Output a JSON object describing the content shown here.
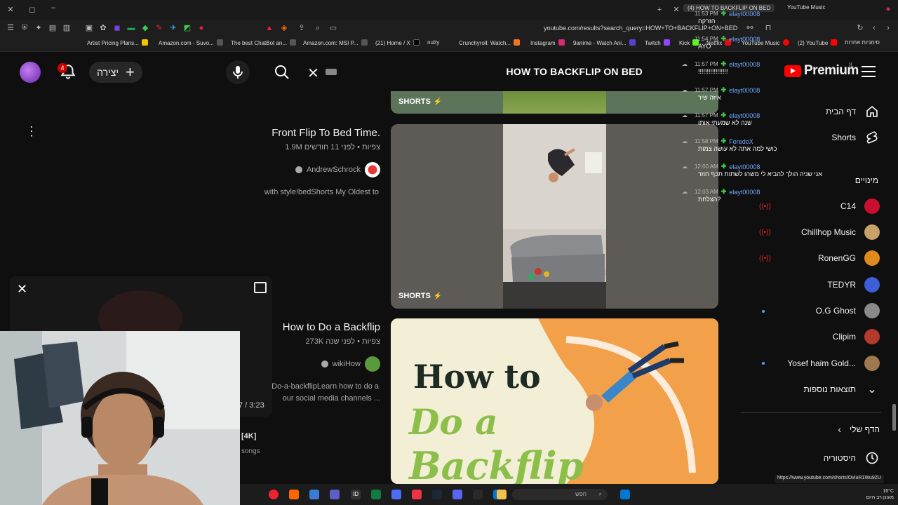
{
  "browser": {
    "tabs": [
      {
        "label": "(4) HOW TO BACKFLIP ON BED",
        "active": true
      },
      {
        "label": "YouTube Music",
        "active": false
      }
    ],
    "url": "youtube.com/results?search_query=HOW+TO+BACKFLIP+ON+BED",
    "bookmarks": [
      "Artist Pricing Plans...",
      "Amazon.com - Suvo...",
      "The best ChatBot an...",
      "Amazon.com: MSI P...",
      "(21) Home / X",
      "nutty",
      "Crunchyroll: Watch...",
      "Instagram",
      "9anime - Watch Ani...",
      "Twitch",
      "Kick",
      "Netflix",
      "YouTube Music",
      "(2) YouTube",
      "סימניות אחרות"
    ],
    "status_url": "https://www.youtube.com/shorts/OvIuR1Wu9ZU"
  },
  "header": {
    "notification_count": "4",
    "create_label": "יצירה",
    "search_value": "HOW TO BACKFLIP ON BED",
    "premium_label": "Premium",
    "region": "IL"
  },
  "results": [
    {
      "kind": "shorts-strip",
      "shorts_label": "SHORTS"
    },
    {
      "title": "Front Flip To Bed Time.",
      "meta": "1.9M צפיות • לפני 11 חודשים",
      "channel": "AndrewSchrock",
      "description": "with style!bedShorts My Oldest to",
      "shorts_label": "SHORTS"
    },
    {
      "title": "How to Do a Backflip",
      "meta": "273K צפיות • לפני שנה",
      "channel": "wikiHow",
      "description_line1": "Do-a-backflipLearn how to do a",
      "description_line2": "our social media channels ...",
      "thumb_text_1": "How to",
      "thumb_text_2": "Do a",
      "thumb_text_3": "Backflip"
    }
  ],
  "miniplayer": {
    "duration": "7 / 3:23",
    "badge": "[4K]",
    "subtitle": "songs"
  },
  "sidebar": {
    "items": [
      {
        "label": "דף הבית",
        "icon": "home-icon"
      },
      {
        "label": "Shorts",
        "icon": "shorts-icon"
      }
    ],
    "subscriptions_label": "מינויים",
    "subscriptions": [
      {
        "name": "C14",
        "live": true,
        "color": "#c8102e"
      },
      {
        "name": "Chillhop Music",
        "live": true,
        "color": "#c9a06a"
      },
      {
        "name": "RonenGG",
        "live": true,
        "color": "#e08a1e"
      },
      {
        "name": "TEDYR",
        "live": false,
        "color": "#3c5fd8"
      },
      {
        "name": "O.G Ghost",
        "live": false,
        "new": true,
        "color": "#8a8a8a"
      },
      {
        "name": "Clipim",
        "live": false,
        "color": "#b33a2b"
      },
      {
        "name": "Yosef haim Gold...",
        "live": false,
        "new": true,
        "color": "#a07850"
      }
    ],
    "more_label": "תוצאות נוספות",
    "you_label": "הדף שלי",
    "history_label": "היסטוריה"
  },
  "chat": [
    {
      "time": "11:53 PM",
      "user": "elayt00008",
      "text": "הזרקה"
    },
    {
      "time": "11:54 PM",
      "user": "elayt00008",
      "text": "AYO"
    },
    {
      "time": "11:57 PM",
      "user": "elayt00008",
      "text": "!!!!!!!!!!!!!!!!!"
    },
    {
      "time": "11:57 PM",
      "user": "elayt00008",
      "text": "איזה שיר"
    },
    {
      "time": "11:57 PM",
      "user": "elayt00008",
      "text": "שנה לא שמעתי אותו"
    },
    {
      "time": "11:58 PM",
      "user": "FeredoX",
      "text": "כושי למה אתה לא עושה צמות"
    },
    {
      "time": "12:00 AM",
      "user": "elayt00008",
      "text": "אני שניה הולך להביא לי משהו לשתות תכף חוזר"
    },
    {
      "time": "12:03 AM",
      "user": "elayt00008",
      "text": "הצלחת?"
    }
  ],
  "taskbar": {
    "search_placeholder": "חפש",
    "weather_temp": "16°C",
    "weather_desc": "מעונן רב היום"
  },
  "colors": {
    "background": "#0f0f0f",
    "youtube_red": "#ff0000",
    "chat_badge": "#3ecf4a",
    "chat_name": "#6fa8ff"
  }
}
